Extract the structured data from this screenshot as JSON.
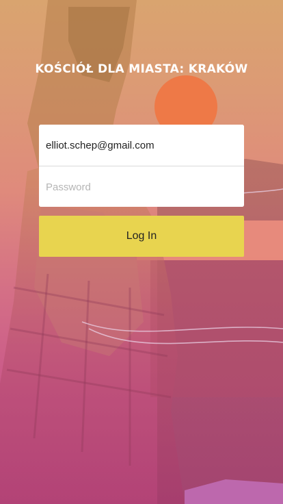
{
  "header": {
    "title": "KOŚCIÓŁ DLA MIASTA: KRAKÓW"
  },
  "login": {
    "email_value": "elliot.schep@gmail.com",
    "password_placeholder": "Password",
    "button_label": "Log In"
  },
  "colors": {
    "button_background": "#e8d44f",
    "card_background": "#ffffff",
    "title_color": "#ffffff"
  },
  "background": {
    "icon": "photo-collage-background"
  }
}
